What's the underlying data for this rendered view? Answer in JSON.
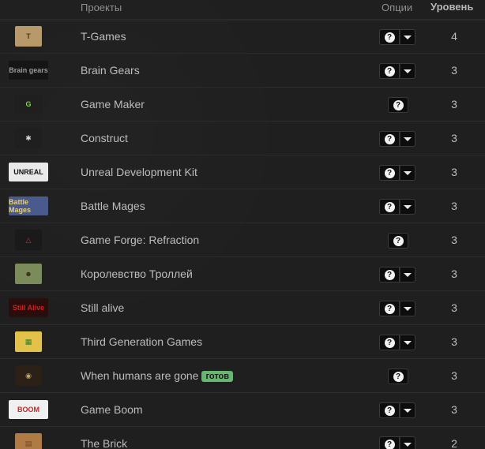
{
  "header": {
    "projects": "Проекты",
    "options": "Опции",
    "level": "Уровень"
  },
  "rows": [
    {
      "name": "T-Games",
      "level": "4",
      "options": "pair",
      "badge": "",
      "thumb": {
        "icon": "t-games-logo",
        "bg": "#b89a6a",
        "fg": "#4a3a1f",
        "text": "T"
      }
    },
    {
      "name": "Brain Gears",
      "level": "3",
      "options": "pair",
      "badge": "",
      "thumb": {
        "icon": "brain-gears-logo",
        "bg": "#151515",
        "fg": "#9a9a9a",
        "text": "Brain gears"
      }
    },
    {
      "name": "Game Maker",
      "level": "3",
      "options": "single",
      "badge": "",
      "thumb": {
        "icon": "game-maker-logo",
        "bg": "#1f1f1f",
        "fg": "#7fd63a",
        "text": "G"
      }
    },
    {
      "name": "Construct",
      "level": "3",
      "options": "pair",
      "badge": "",
      "thumb": {
        "icon": "construct-logo",
        "bg": "#1f1f1f",
        "fg": "#d9d9d9",
        "text": "✱"
      }
    },
    {
      "name": "Unreal Development Kit",
      "level": "3",
      "options": "pair",
      "badge": "",
      "thumb": {
        "icon": "unreal-logo",
        "bg": "#e9e9e9",
        "fg": "#111111",
        "text": "UNREAL"
      }
    },
    {
      "name": "Battle Mages",
      "level": "3",
      "options": "pair",
      "badge": "",
      "thumb": {
        "icon": "battle-mages-logo",
        "bg": "#4b5a8c",
        "fg": "#e6d07a",
        "text": "Battle Mages"
      }
    },
    {
      "name": "Game Forge: Refraction",
      "level": "3",
      "options": "single",
      "badge": "",
      "thumb": {
        "icon": "game-forge-logo",
        "bg": "#1a1a1a",
        "fg": "#d52b2b",
        "text": "△"
      }
    },
    {
      "name": "Королевство Троллей",
      "level": "3",
      "options": "pair",
      "badge": "",
      "thumb": {
        "icon": "troll-kingdom-logo",
        "bg": "#7b8b5a",
        "fg": "#3a2a18",
        "text": "☻"
      }
    },
    {
      "name": "Still alive",
      "level": "3",
      "options": "pair",
      "badge": "",
      "thumb": {
        "icon": "still-alive-logo",
        "bg": "#2a0d0d",
        "fg": "#c42626",
        "text": "Still Alive"
      }
    },
    {
      "name": "Third Generation Games",
      "level": "3",
      "options": "pair",
      "badge": "",
      "thumb": {
        "icon": "third-generation-logo",
        "bg": "#e3c24a",
        "fg": "#2d7d2d",
        "text": "▦"
      }
    },
    {
      "name": "When humans are gone",
      "level": "3",
      "options": "single",
      "badge": "готов",
      "thumb": {
        "icon": "when-humans-logo",
        "bg": "#2b2117",
        "fg": "#c6a36a",
        "text": "◉"
      }
    },
    {
      "name": "Game Boom",
      "level": "3",
      "options": "pair",
      "badge": "",
      "thumb": {
        "icon": "game-boom-logo",
        "bg": "#f0f0f0",
        "fg": "#c02a2a",
        "text": "BOOM"
      }
    },
    {
      "name": "The Brick",
      "level": "2",
      "options": "pair",
      "badge": "",
      "thumb": {
        "icon": "the-brick-logo",
        "bg": "#b07a45",
        "fg": "#6b4323",
        "text": "▤"
      }
    }
  ],
  "colors": {
    "badge_bg": "#66b672",
    "background": "#1f1f1f"
  },
  "icons": {
    "help": "question-icon",
    "dropdown": "chevron-down-icon"
  }
}
